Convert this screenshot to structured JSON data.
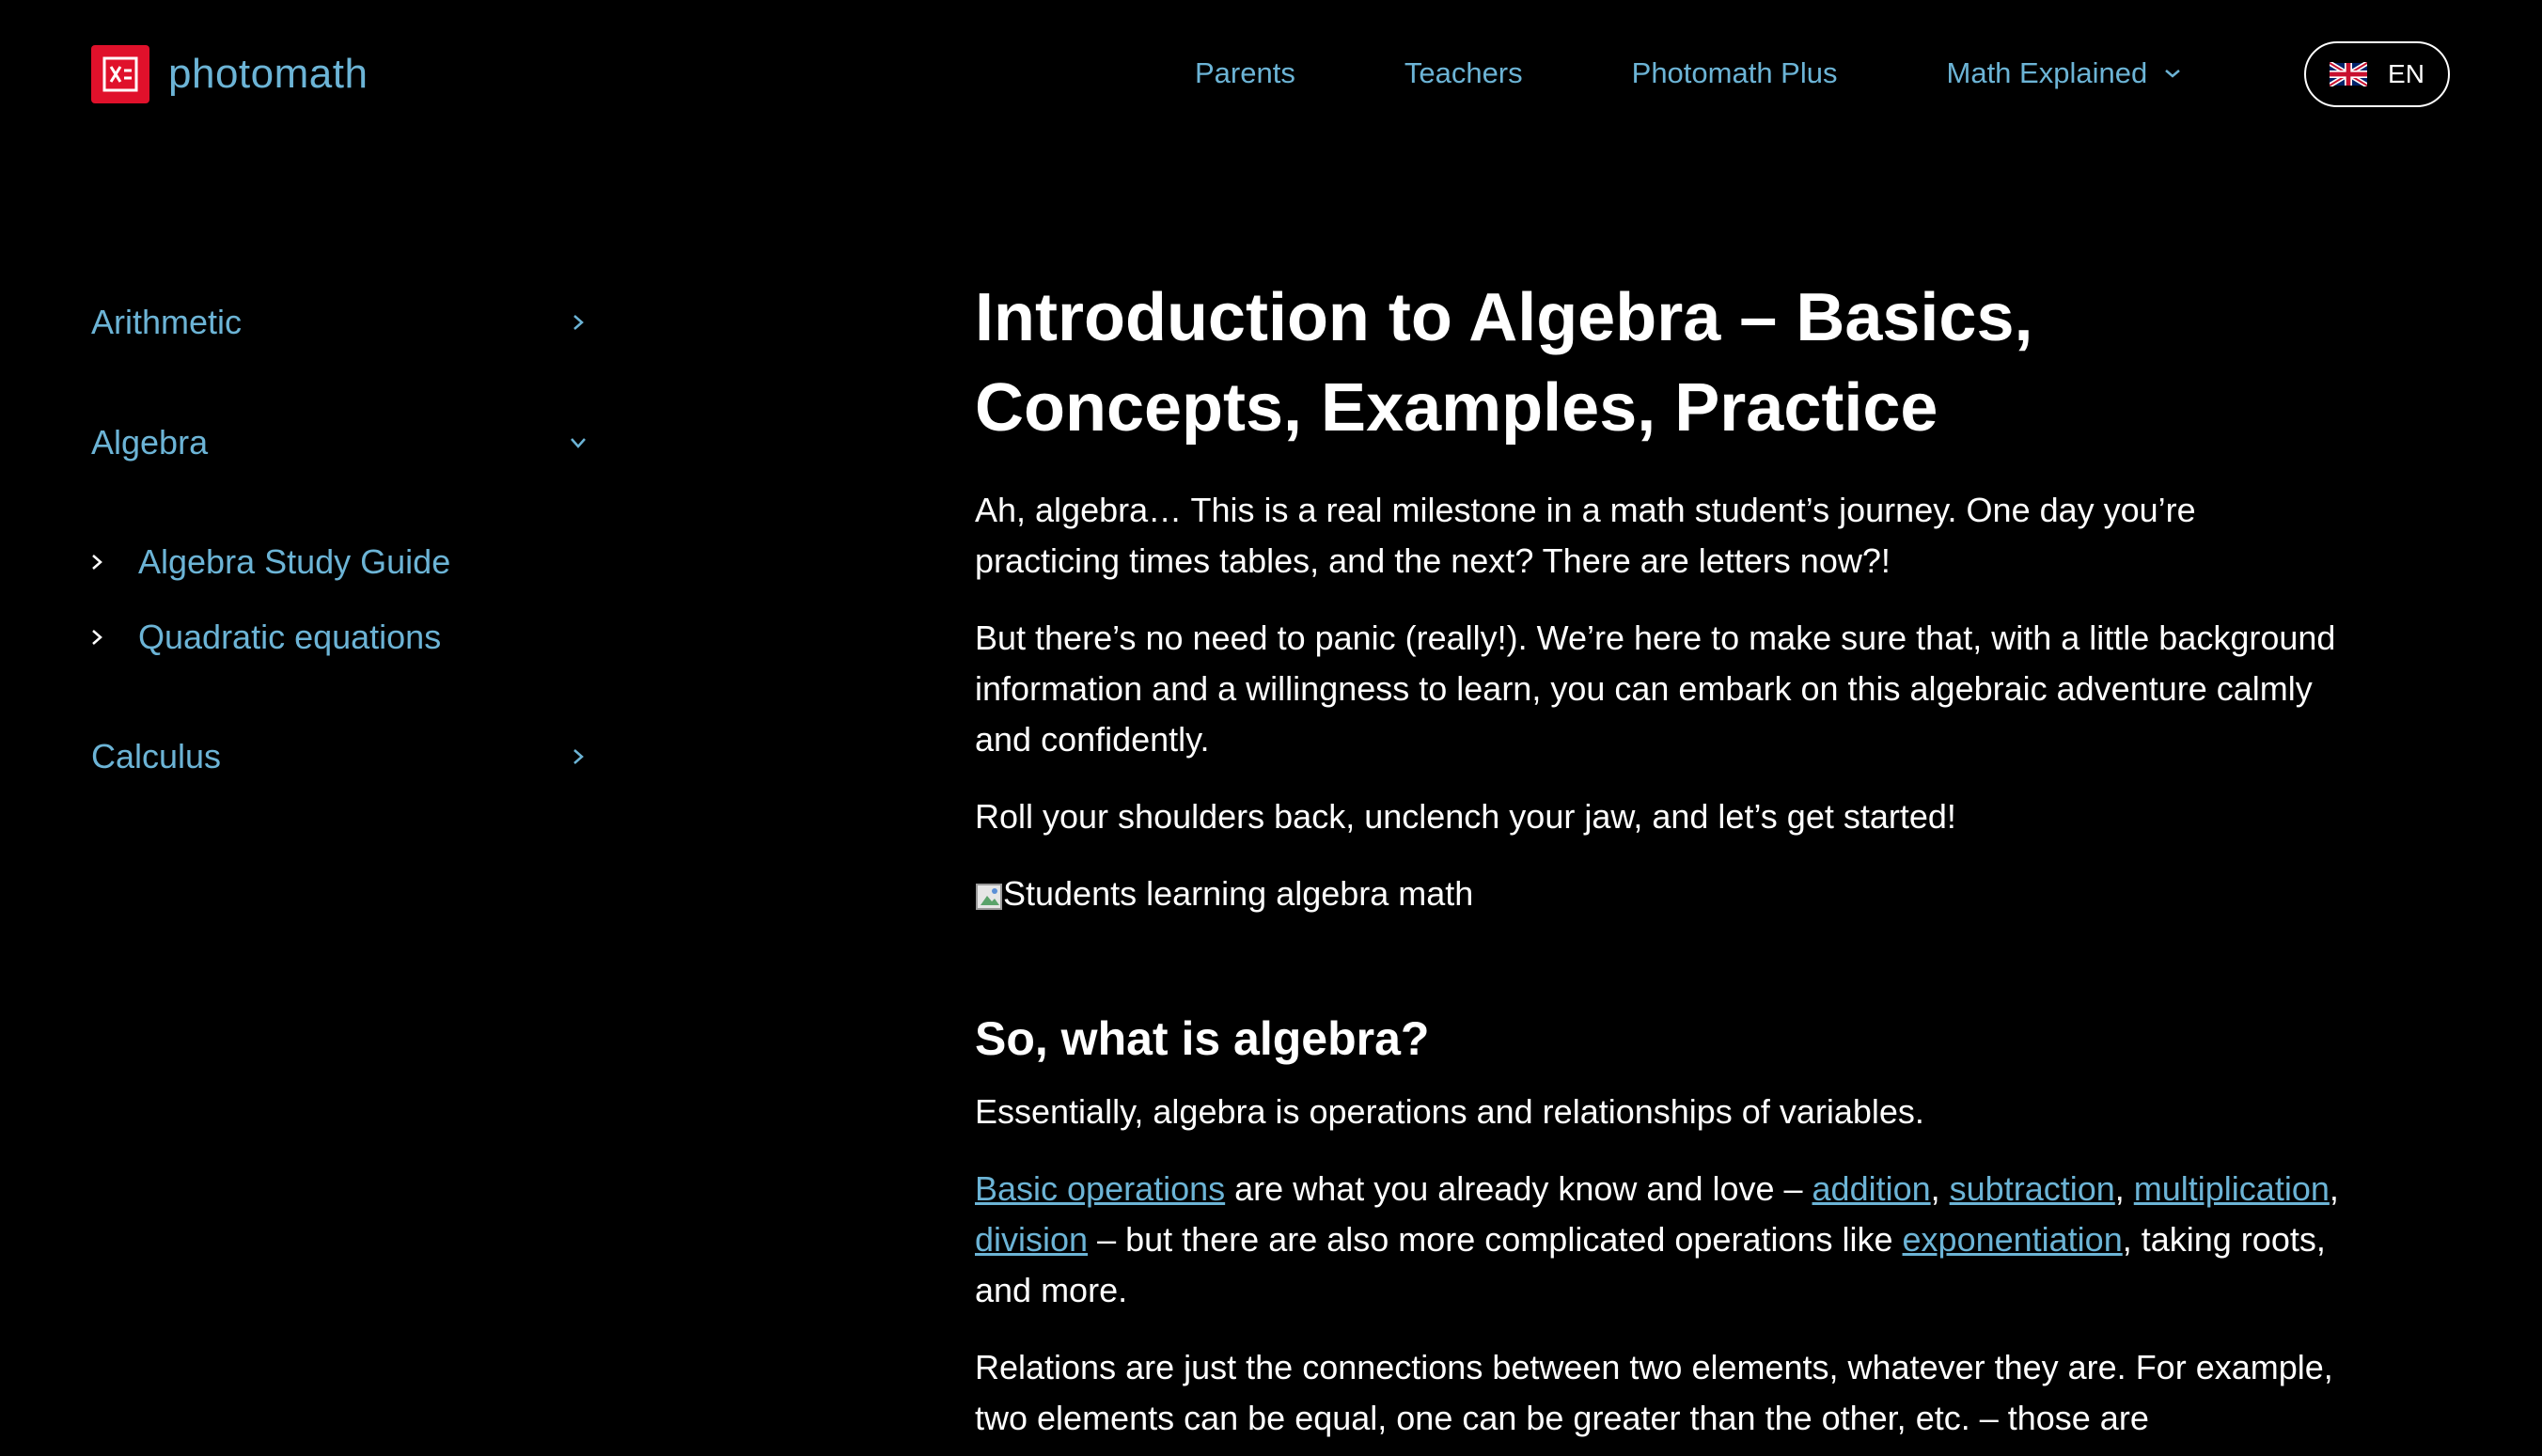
{
  "header": {
    "logo_text": "photomath",
    "nav": [
      {
        "label": "Parents"
      },
      {
        "label": "Teachers"
      },
      {
        "label": "Photomath Plus"
      },
      {
        "label": "Math Explained",
        "has_dropdown": true
      }
    ],
    "language": "EN"
  },
  "sidebar": {
    "categories": [
      {
        "label": "Arithmetic",
        "expanded": false
      },
      {
        "label": "Algebra",
        "expanded": true,
        "children": [
          "Algebra Study Guide",
          "Quadratic equations"
        ]
      },
      {
        "label": "Calculus",
        "expanded": false
      }
    ]
  },
  "article": {
    "title": "Introduction to Algebra – Basics, Concepts, Examples, Practice",
    "intro_1": "Ah, algebra… This is a real milestone in a math student’s journey. One day you’re practicing times tables, and the next? There are letters now?!",
    "intro_2": "But there’s no need to panic (really!). We’re here to make sure that, with a little background information and a willingness to learn, you can embark on this algebraic adventure calmly and confidently.",
    "intro_3": "Roll your shoulders back, unclench your jaw, and let’s get started!",
    "image_alt": "Students learning algebra math",
    "section_heading": "So, what is algebra?",
    "section_p1": "Essentially, algebra is operations and relationships of variables.",
    "section_p2": {
      "link_basic_operations": "Basic operations",
      "text_1": " are what you already know and love – ",
      "link_addition": "addition",
      "sep_1": ", ",
      "link_subtraction": "subtraction",
      "sep_2": ", ",
      "link_multiplication": "multiplication",
      "sep_3": ", ",
      "link_division": "division",
      "text_2": " – but there are also more complicated operations like ",
      "link_exponentiation": "exponentiation",
      "text_3": ", taking roots, and more."
    },
    "section_p3": "Relations are just the connections between two elements, whatever they are. For example, two elements can be equal, one can be greater than the other, etc. – those are"
  },
  "colors": {
    "background": "#000000",
    "link": "#6cb4d6",
    "logo_red": "#e0112b",
    "text": "#ffffff"
  }
}
